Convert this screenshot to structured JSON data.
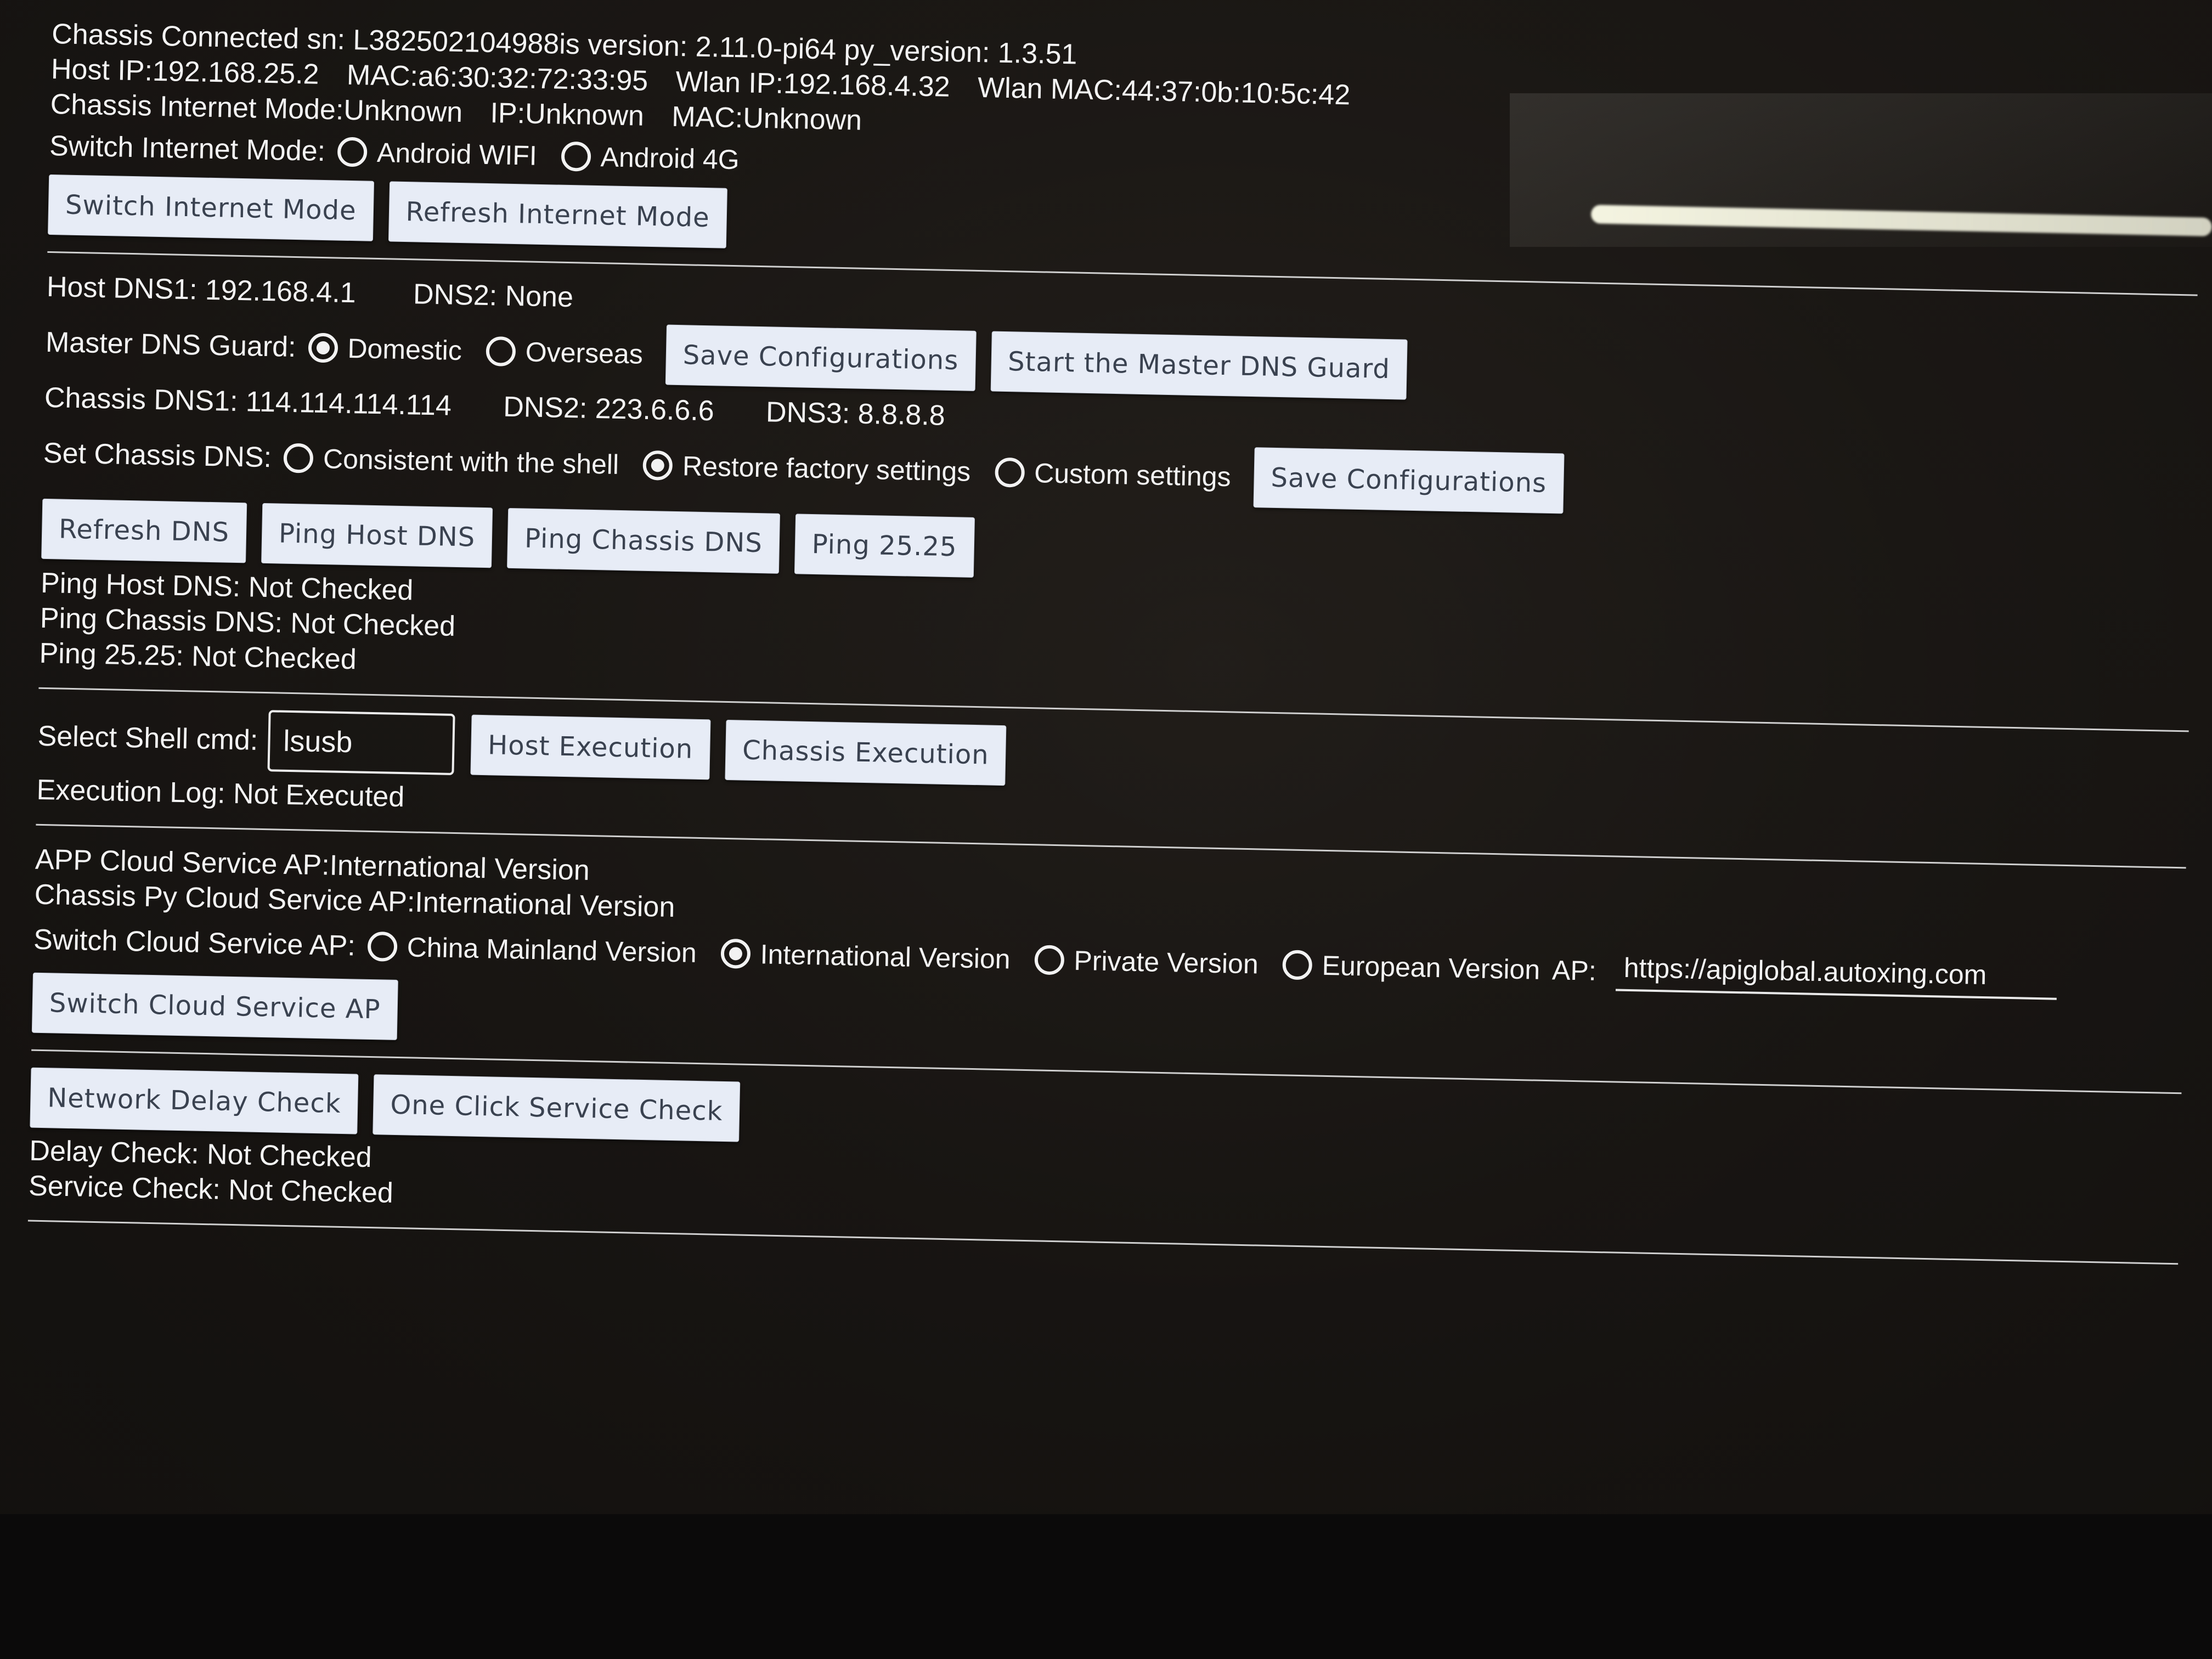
{
  "header": {
    "line1": "Chassis Connected sn: L382502104988is version: 2.11.0-pi64 py_version: 1.3.51",
    "host_ip": "Host IP:192.168.25.2",
    "host_mac": "MAC:a6:30:32:72:33:95",
    "wlan_ip": "Wlan IP:192.168.4.32",
    "wlan_mac": "Wlan MAC:44:37:0b:10:5c:42",
    "chassis_mode": "Chassis Internet Mode:Unknown",
    "chassis_ip": "IP:Unknown",
    "chassis_mac": "MAC:Unknown"
  },
  "internet": {
    "label": "Switch Internet Mode:",
    "options": [
      "Android WIFI",
      "Android 4G"
    ],
    "switch_btn": "Switch Internet Mode",
    "refresh_btn": "Refresh Internet Mode"
  },
  "dns": {
    "host_dns1": "Host DNS1: 192.168.4.1",
    "host_dns2": "DNS2: None",
    "guard_label": "Master DNS Guard:",
    "guard_options": [
      "Domestic",
      "Overseas"
    ],
    "guard_selected": "Domestic",
    "save_btn_1": "Save Configurations",
    "start_guard_btn": "Start the Master DNS Guard",
    "chassis_dns1": "Chassis DNS1: 114.114.114.114",
    "chassis_dns2": "DNS2: 223.6.6.6",
    "chassis_dns3": "DNS3: 8.8.8.8",
    "set_label": "Set Chassis DNS:",
    "set_options": [
      "Consistent with the shell",
      "Restore factory settings",
      "Custom settings"
    ],
    "set_selected": "Restore factory settings",
    "save_btn_2": "Save Configurations",
    "refresh_btn": "Refresh DNS",
    "ping_host_btn": "Ping Host DNS",
    "ping_chassis_btn": "Ping Chassis DNS",
    "ping_2525_btn": "Ping 25.25",
    "ping_host_status": "Ping Host DNS: Not Checked",
    "ping_chassis_status": "Ping Chassis DNS: Not Checked",
    "ping_2525_status": "Ping 25.25: Not Checked"
  },
  "shell": {
    "label": "Select Shell cmd:",
    "value": "lsusb",
    "host_btn": "Host Execution",
    "chassis_btn": "Chassis Execution",
    "log": "Execution Log: Not Executed"
  },
  "cloud": {
    "app_ap": "APP Cloud Service AP:International Version",
    "chassis_ap": "Chassis Py Cloud Service AP:International Version",
    "switch_label": "Switch Cloud Service AP:",
    "options": [
      "China Mainland Version",
      "International Version",
      "Private Version",
      "European Version"
    ],
    "selected": "International Version",
    "ap_label": "AP:",
    "ap_value": "https://apiglobal.autoxing.com",
    "switch_btn": "Switch Cloud Service AP"
  },
  "checks": {
    "delay_btn": "Network Delay Check",
    "service_btn": "One Click Service Check",
    "delay_status": "Delay Check: Not Checked",
    "service_status": "Service Check: Not Checked"
  }
}
